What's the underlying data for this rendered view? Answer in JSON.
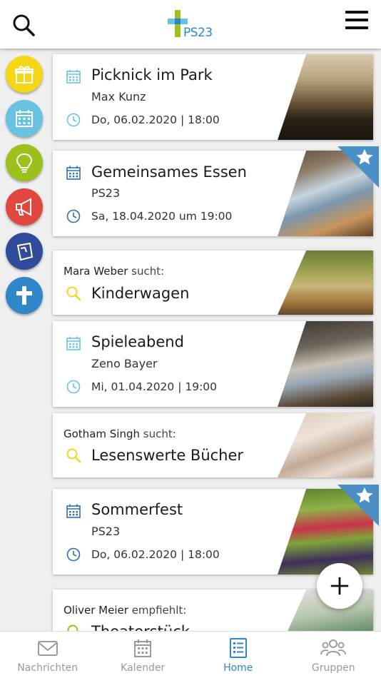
{
  "header": {
    "logo_text": "PS23"
  },
  "sidebar": [
    {
      "name": "gift-icon",
      "color": "#f4d716"
    },
    {
      "name": "calendar-icon",
      "color": "#68c3e3"
    },
    {
      "name": "lightbulb-icon",
      "color": "#9bc11a"
    },
    {
      "name": "megaphone-icon",
      "color": "#e2473f"
    },
    {
      "name": "note-icon",
      "color": "#2f4b9a"
    },
    {
      "name": "cross-icon",
      "color": "#2f86c8"
    }
  ],
  "cards": {
    "c1": {
      "title": "Picknick im Park",
      "sub": "Max Kunz",
      "time": "Do, 06.02.2020 | 18:00"
    },
    "c2": {
      "title": "Gemeinsames Essen",
      "sub": "PS23",
      "time": "Sa, 18.04.2020 um 19:00"
    },
    "c3": {
      "name": "Mara Weber",
      "verb": "sucht:",
      "title": "Kinderwagen"
    },
    "c4": {
      "title": "Spieleabend",
      "sub": "Zeno Bayer",
      "time": "Mi, 01.04.2020 | 19:00"
    },
    "c5": {
      "name": "Gotham Singh",
      "verb": "sucht:",
      "title": "Lesenswerte Bücher"
    },
    "c6": {
      "title": "Sommerfest",
      "sub": "PS23",
      "time": "Do, 06.02.2020 | 18:00"
    },
    "c7": {
      "name": "Oliver Meier",
      "verb": "empfiehlt:",
      "title": "Theaterstück"
    }
  },
  "tabs": [
    {
      "label": "Nachrichten"
    },
    {
      "label": "Kalender"
    },
    {
      "label": "Home"
    },
    {
      "label": "Gruppen"
    }
  ],
  "colors": {
    "accent": "#2f86c8",
    "light_blue": "#68c3e3",
    "dark_blue": "#2f6fa8",
    "search_yellow": "#f4d716",
    "star_badge": "#4a8fc6"
  }
}
